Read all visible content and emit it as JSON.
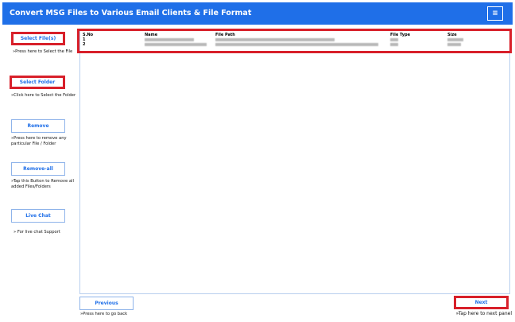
{
  "header": {
    "title": "Convert MSG Files to Various Email Clients & File Format",
    "menu_icon": "hamburger-icon",
    "menu_symbol": "≡"
  },
  "sidebar": [
    {
      "label": "Select File(s)",
      "hint": "»Press here to Select the File"
    },
    {
      "label": "Select Folder",
      "hint": "»Click here to Select the Folder"
    },
    {
      "label": "Remove",
      "hint": "»Press here to remove any particular File / Folder"
    },
    {
      "label": "Remove-all",
      "hint": "»Tap this Button to Remove all added Files/Folders"
    },
    {
      "label": "Live Chat",
      "hint": "» For live chat Support"
    }
  ],
  "table": {
    "columns": [
      "S.No",
      "Name",
      "File Path",
      "File Type",
      "Size"
    ],
    "rows": [
      {
        "sno": "1"
      },
      {
        "sno": "2"
      }
    ]
  },
  "footer": {
    "previous": "Previous",
    "previous_hint": "»Press here to go back",
    "next": "Next",
    "next_hint": "»Tap here to next panel"
  },
  "colors": {
    "brand": "#1f6fe8",
    "highlight": "#d8202a"
  }
}
